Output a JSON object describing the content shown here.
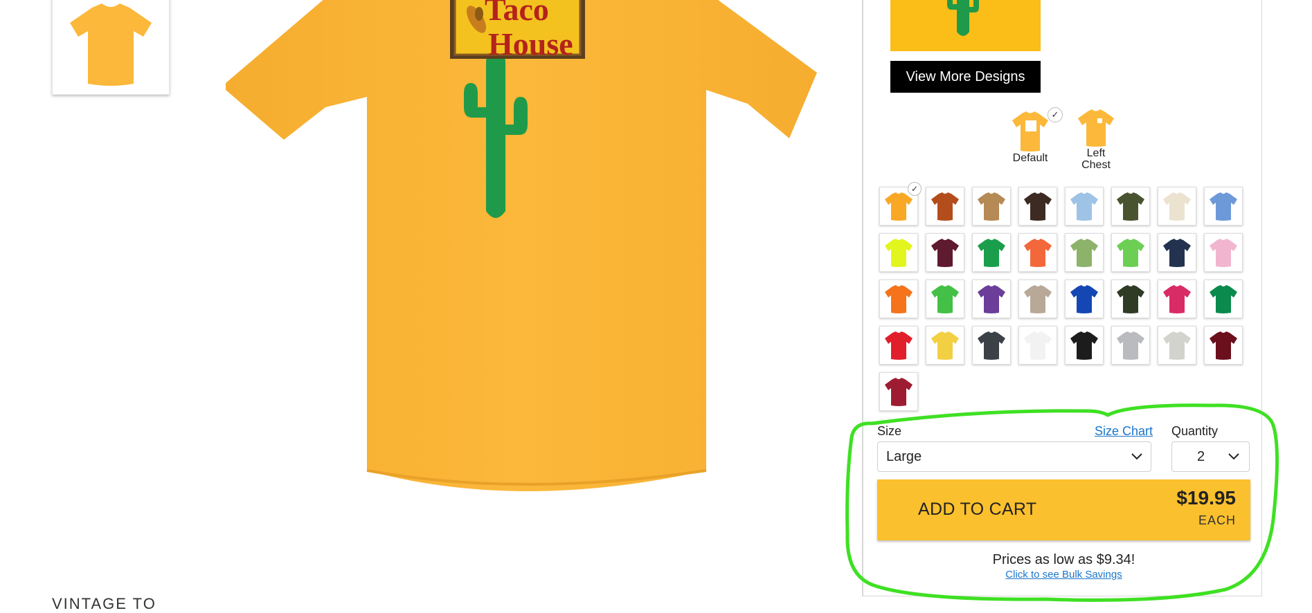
{
  "gallery": {
    "thumbnail_alt": "shirt-thumbnail",
    "below_label": "VINTAGE TO"
  },
  "design": {
    "sign_line1": "Taco",
    "sign_line2": "House",
    "shirt_color": "#fbb83a",
    "view_more_label": "View More Designs"
  },
  "print_options": [
    {
      "label": "Default",
      "selected": true
    },
    {
      "label": "Left Chest",
      "selected": false
    }
  ],
  "colors": [
    {
      "hex": "#f9a825",
      "selected": true
    },
    {
      "hex": "#b34d1c"
    },
    {
      "hex": "#b68a55"
    },
    {
      "hex": "#3d2a22"
    },
    {
      "hex": "#9ec3e6"
    },
    {
      "hex": "#4a5330"
    },
    {
      "hex": "#ebe3d0"
    },
    {
      "hex": "#6d99d9"
    },
    {
      "hex": "#e2f51c"
    },
    {
      "hex": "#5e1a2e"
    },
    {
      "hex": "#1b9e4b"
    },
    {
      "hex": "#f2683a"
    },
    {
      "hex": "#8db36b"
    },
    {
      "hex": "#6ccf54"
    },
    {
      "hex": "#23324e"
    },
    {
      "hex": "#f2b5cf"
    },
    {
      "hex": "#f5731b"
    },
    {
      "hex": "#44c047"
    },
    {
      "hex": "#6a3e99"
    },
    {
      "hex": "#b8a897"
    },
    {
      "hex": "#1447b3"
    },
    {
      "hex": "#2f3b25"
    },
    {
      "hex": "#d92b66"
    },
    {
      "hex": "#0a8a4d"
    },
    {
      "hex": "#e01f2a"
    },
    {
      "hex": "#f3cf44"
    },
    {
      "hex": "#3b4146"
    },
    {
      "hex": "#f2f2f2"
    },
    {
      "hex": "#1c1c1c"
    },
    {
      "hex": "#b9bbbe"
    },
    {
      "hex": "#d3d3cd"
    },
    {
      "hex": "#6b0f1d"
    },
    {
      "hex": "#9e1c31"
    }
  ],
  "size": {
    "label": "Size",
    "chart_link": "Size Chart",
    "value": "Large"
  },
  "quantity": {
    "label": "Quantity",
    "value": "2"
  },
  "cart": {
    "button_label": "ADD TO CART",
    "price": "$19.95",
    "unit": "EACH"
  },
  "bulk": {
    "headline": "Prices as low as $9.34!",
    "link": "Click to see Bulk Savings"
  },
  "theme": {
    "accent_yellow": "#fbc02d",
    "link_blue": "#1a75c9",
    "highlight_green": "#3fe023"
  }
}
